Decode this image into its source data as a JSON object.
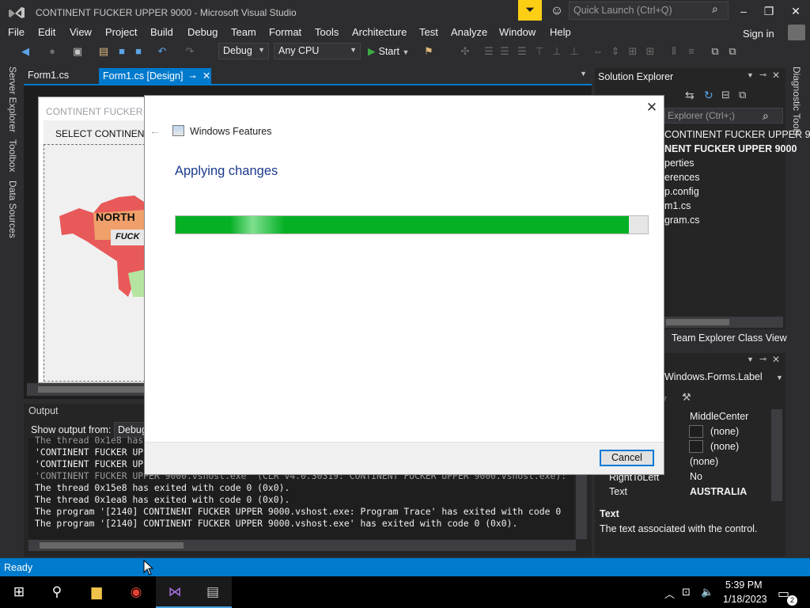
{
  "window": {
    "title": "CONTINENT FUCKER UPPER 9000 - Microsoft Visual Studio",
    "quick_launch_placeholder": "Quick Launch (Ctrl+Q)",
    "sign_in": "Sign in"
  },
  "menu": [
    "File",
    "Edit",
    "View",
    "Project",
    "Build",
    "Debug",
    "Team",
    "Format",
    "Tools",
    "Architecture",
    "Test",
    "Analyze",
    "Window",
    "Help"
  ],
  "toolbar": {
    "config": "Debug",
    "platform": "Any CPU",
    "start": "Start"
  },
  "left_tabs": [
    "Server Explorer",
    "Toolbox",
    "Data Sources"
  ],
  "right_tabs": [
    "Diagnostic Tools"
  ],
  "doc_tabs": [
    {
      "label": "Form1.cs",
      "active": false
    },
    {
      "label": "Form1.cs [Design]",
      "active": true
    }
  ],
  "designer": {
    "form_title": "CONTINENT FUCKER UP",
    "menu_label": "SELECT CONTINENT",
    "map_label": "NORTH",
    "button_label": "FUCK"
  },
  "output": {
    "title": "Output",
    "show_from_label": "Show output from:",
    "show_from_value": "Debug",
    "lines": [
      "The thread 0x1e8 has",
      "'CONTINENT FUCKER UP",
      "'CONTINENT FUCKER UP",
      "'CONTINENT FUCKER UPPER 9000.vshost.exe' (CLR v4.0.30319: CONTINENT FUCKER UPPER 9000.vshost.exe):",
      "The thread 0x15e8 has exited with code 0 (0x0).",
      "The thread 0x1ea8 has exited with code 0 (0x0).",
      "The program '[2140] CONTINENT FUCKER UPPER 9000.vshost.exe: Program Trace' has exited with code 0",
      "The program '[2140] CONTINENT FUCKER UPPER 9000.vshost.exe' has exited with code 0 (0x0)."
    ]
  },
  "solution_explorer": {
    "title": "Solution Explorer",
    "search_placeholder": "Explorer (Ctrl+;)",
    "items": [
      "CONTINENT FUCKER UPPER 9",
      "NENT FUCKER UPPER 9000",
      "perties",
      "erences",
      "p.config",
      "m1.cs",
      "gram.cs"
    ],
    "bottom_tabs": [
      "Team Explorer",
      "Class View"
    ]
  },
  "properties": {
    "type": "Windows.Forms.Label",
    "rows": [
      {
        "name": "",
        "value": "MiddleCenter"
      },
      {
        "name": "",
        "value": "(none)"
      },
      {
        "name": "",
        "value": "(none)"
      },
      {
        "name": "",
        "value": "(none)"
      },
      {
        "name": "RightToLeft",
        "value": "No"
      },
      {
        "name": "Text",
        "value": "AUSTRALIA"
      }
    ],
    "desc_name": "Text",
    "desc_text": "The text associated with the control."
  },
  "status": {
    "text": "Ready"
  },
  "taskbar": {
    "time": "5:39 PM",
    "date": "1/18/2023",
    "notifications": "2"
  },
  "dialog": {
    "title": "Windows Features",
    "heading": "Applying changes",
    "progress": 0.96,
    "cancel_label": "Cancel"
  },
  "colors": {
    "accent": "#007acc",
    "progress": "#06b025",
    "heading": "#1b3a8c"
  }
}
